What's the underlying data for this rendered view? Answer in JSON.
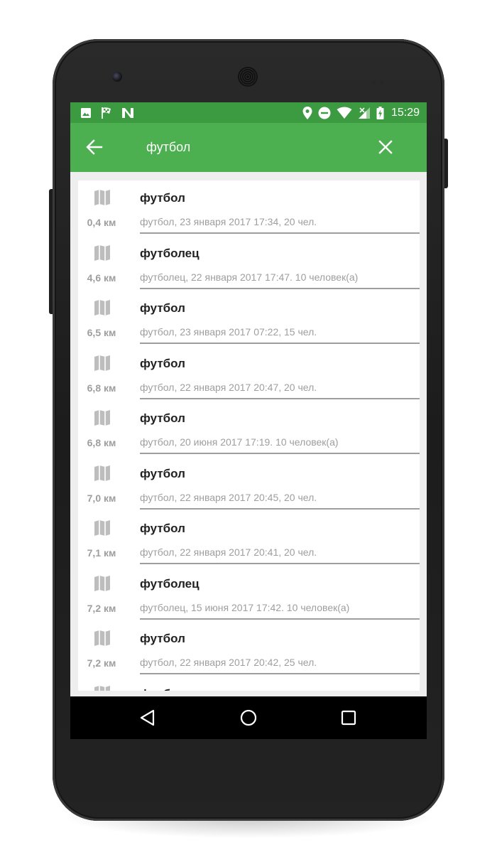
{
  "status_bar": {
    "left_icons": [
      "image-icon",
      "checkered-flag-icon",
      "n-logo-icon"
    ],
    "right_icons": [
      "location-icon",
      "do-not-disturb-icon",
      "wifi-icon",
      "signal-icon",
      "battery-charging-icon"
    ],
    "time": "15:29"
  },
  "toolbar": {
    "search_query": "футбол",
    "back_icon": "arrow-back-icon",
    "close_icon": "close-icon"
  },
  "results": [
    {
      "title": "футбол",
      "distance": "0,4 км",
      "subtitle": "футбол, 23 января 2017 17:34, 20 чел."
    },
    {
      "title": "футболец",
      "distance": "4,6 км",
      "subtitle": "футболец, 22 января 2017 17:47. 10 человек(а)"
    },
    {
      "title": "футбол",
      "distance": "6,5 км",
      "subtitle": "футбол, 23 января 2017 07:22, 15 чел."
    },
    {
      "title": "футбол",
      "distance": "6,8 км",
      "subtitle": "футбол, 22 января 2017 20:47, 20 чел."
    },
    {
      "title": "футбол",
      "distance": "6,8 км",
      "subtitle": "футбол, 20 июня 2017 17:19. 10 человек(а)"
    },
    {
      "title": "футбол",
      "distance": "7,0 км",
      "subtitle": "футбол, 22 января 2017 20:45, 20 чел."
    },
    {
      "title": "футбол",
      "distance": "7,1 км",
      "subtitle": "футбол, 22 января 2017 20:41, 20 чел."
    },
    {
      "title": "футболец",
      "distance": "7,2 км",
      "subtitle": "футболец, 15 июня 2017 17:42. 10 человек(а)"
    },
    {
      "title": "футбол",
      "distance": "7,2 км",
      "subtitle": "футбол, 22 января 2017 20:42, 25 чел."
    },
    {
      "title": "футбол",
      "distance": "",
      "subtitle": ""
    }
  ],
  "nav_bar": {
    "icons": [
      "nav-back-icon",
      "nav-home-icon",
      "nav-recents-icon"
    ]
  },
  "colors": {
    "status_bar": "#3c9b41",
    "toolbar": "#4caf50",
    "list_background": "#eeeeee",
    "secondary_text": "#9e9e9e"
  }
}
